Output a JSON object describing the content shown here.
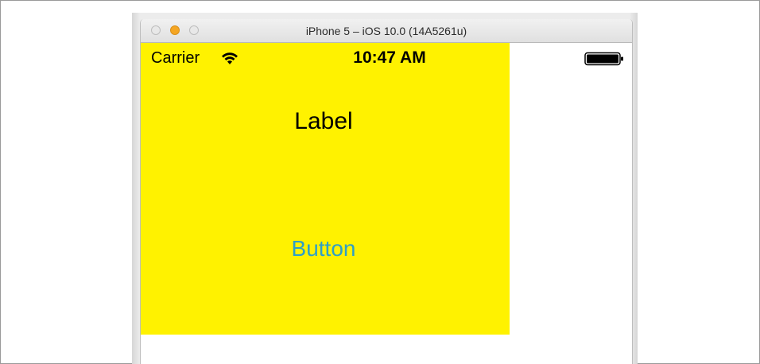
{
  "window": {
    "title": "iPhone 5 – iOS 10.0 (14A5261u)"
  },
  "status_bar": {
    "carrier": "Carrier",
    "time": "10:47 AM",
    "wifi_icon": "wifi-icon",
    "battery_icon": "battery-icon"
  },
  "content": {
    "label": "Label",
    "button": "Button"
  },
  "colors": {
    "view_background": "#fff200",
    "button_tint": "#2f9fc7",
    "minimize_button": "#f5a623"
  }
}
